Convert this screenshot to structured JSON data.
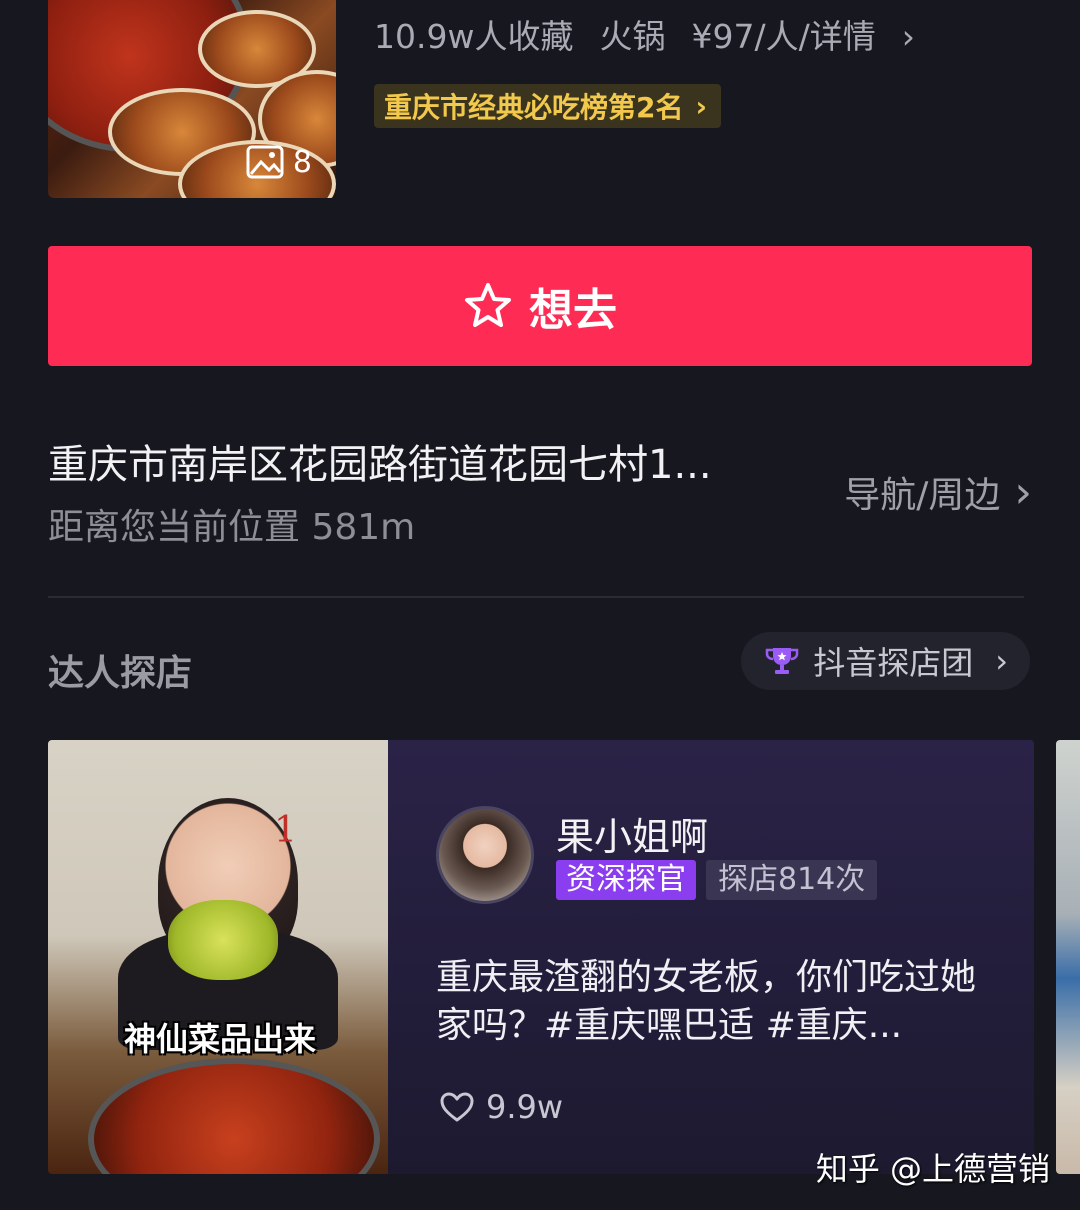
{
  "store": {
    "photo_count": "8",
    "favorites": "10.9w人收藏",
    "category": "火锅",
    "price": "¥97/人/详情",
    "price_chevron": "›",
    "rank_text": "重庆市经典必吃榜第2名",
    "rank_chevron": "›"
  },
  "want_button": {
    "label": "想去"
  },
  "location": {
    "address": "重庆市南岸区花园路街道花园七村1...",
    "distance": "距离您当前位置 581m",
    "nav_label": "导航/周边",
    "nav_chevron": "›"
  },
  "section": {
    "title": "达人探店",
    "team_label": "抖音探店团",
    "team_chevron": "›"
  },
  "card": {
    "thumb_number": "1",
    "thumb_caption": "神仙菜品出来",
    "author": "果小姐啊",
    "tag_level": "资深探官",
    "tag_visits": "探店814次",
    "description": "重庆最渣翻的女老板，你们吃过她家吗？#重庆嘿巴适 #重庆...",
    "likes": "9.9w"
  },
  "watermark": "知乎 @上德营销",
  "colors": {
    "background": "#16171f",
    "accent": "#fe2c55",
    "rank_gold": "#f2c94c",
    "tag_purple": "#8b3df0"
  }
}
